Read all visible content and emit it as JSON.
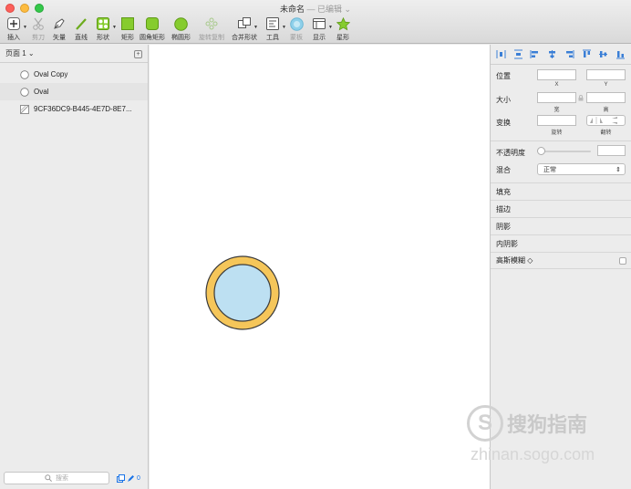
{
  "window": {
    "title": "未命名",
    "subtitle": "— 已编辑 ⌄"
  },
  "toolbar": {
    "insert": "插入",
    "scissors": "剪刀",
    "vector": "矢量",
    "line": "直线",
    "shape": "形状",
    "rectangle": "矩形",
    "rounded_rect": "圆角矩形",
    "oval": "椭圆形",
    "rotate_copy": "旋转复制",
    "combine": "合并形状",
    "tools": "工具",
    "mask": "蒙板",
    "display": "显示",
    "star": "星形"
  },
  "layers_panel": {
    "page_label": "页面 1 ⌄",
    "layers": [
      {
        "name": "Oval Copy",
        "icon": "oval-icon"
      },
      {
        "name": "Oval",
        "icon": "oval-icon"
      },
      {
        "name": "9CF36DC9-B445-4E7D-8E7...",
        "icon": "image-icon"
      }
    ],
    "search_placeholder": "搜索",
    "edit_count": "0"
  },
  "canvas": {
    "shape_fill": "#bde0f2",
    "shape_ring": "#f5c65a",
    "shape_stroke": "#3b3b3b"
  },
  "inspector": {
    "position": "位置",
    "x": "X",
    "y": "Y",
    "size": "大小",
    "width": "宽",
    "height": "高",
    "transform": "变换",
    "rotate": "旋转",
    "flip": "翻转",
    "opacity": "不透明度",
    "blend": "混合",
    "blend_value": "正常",
    "fill": "填充",
    "border": "描边",
    "shadow": "阴影",
    "inner_shadow": "内阴影",
    "gaussian_blur": "高斯模糊 ◇"
  },
  "watermark": {
    "brand": "搜狗指南",
    "url": "zhinan.sogo.com"
  }
}
